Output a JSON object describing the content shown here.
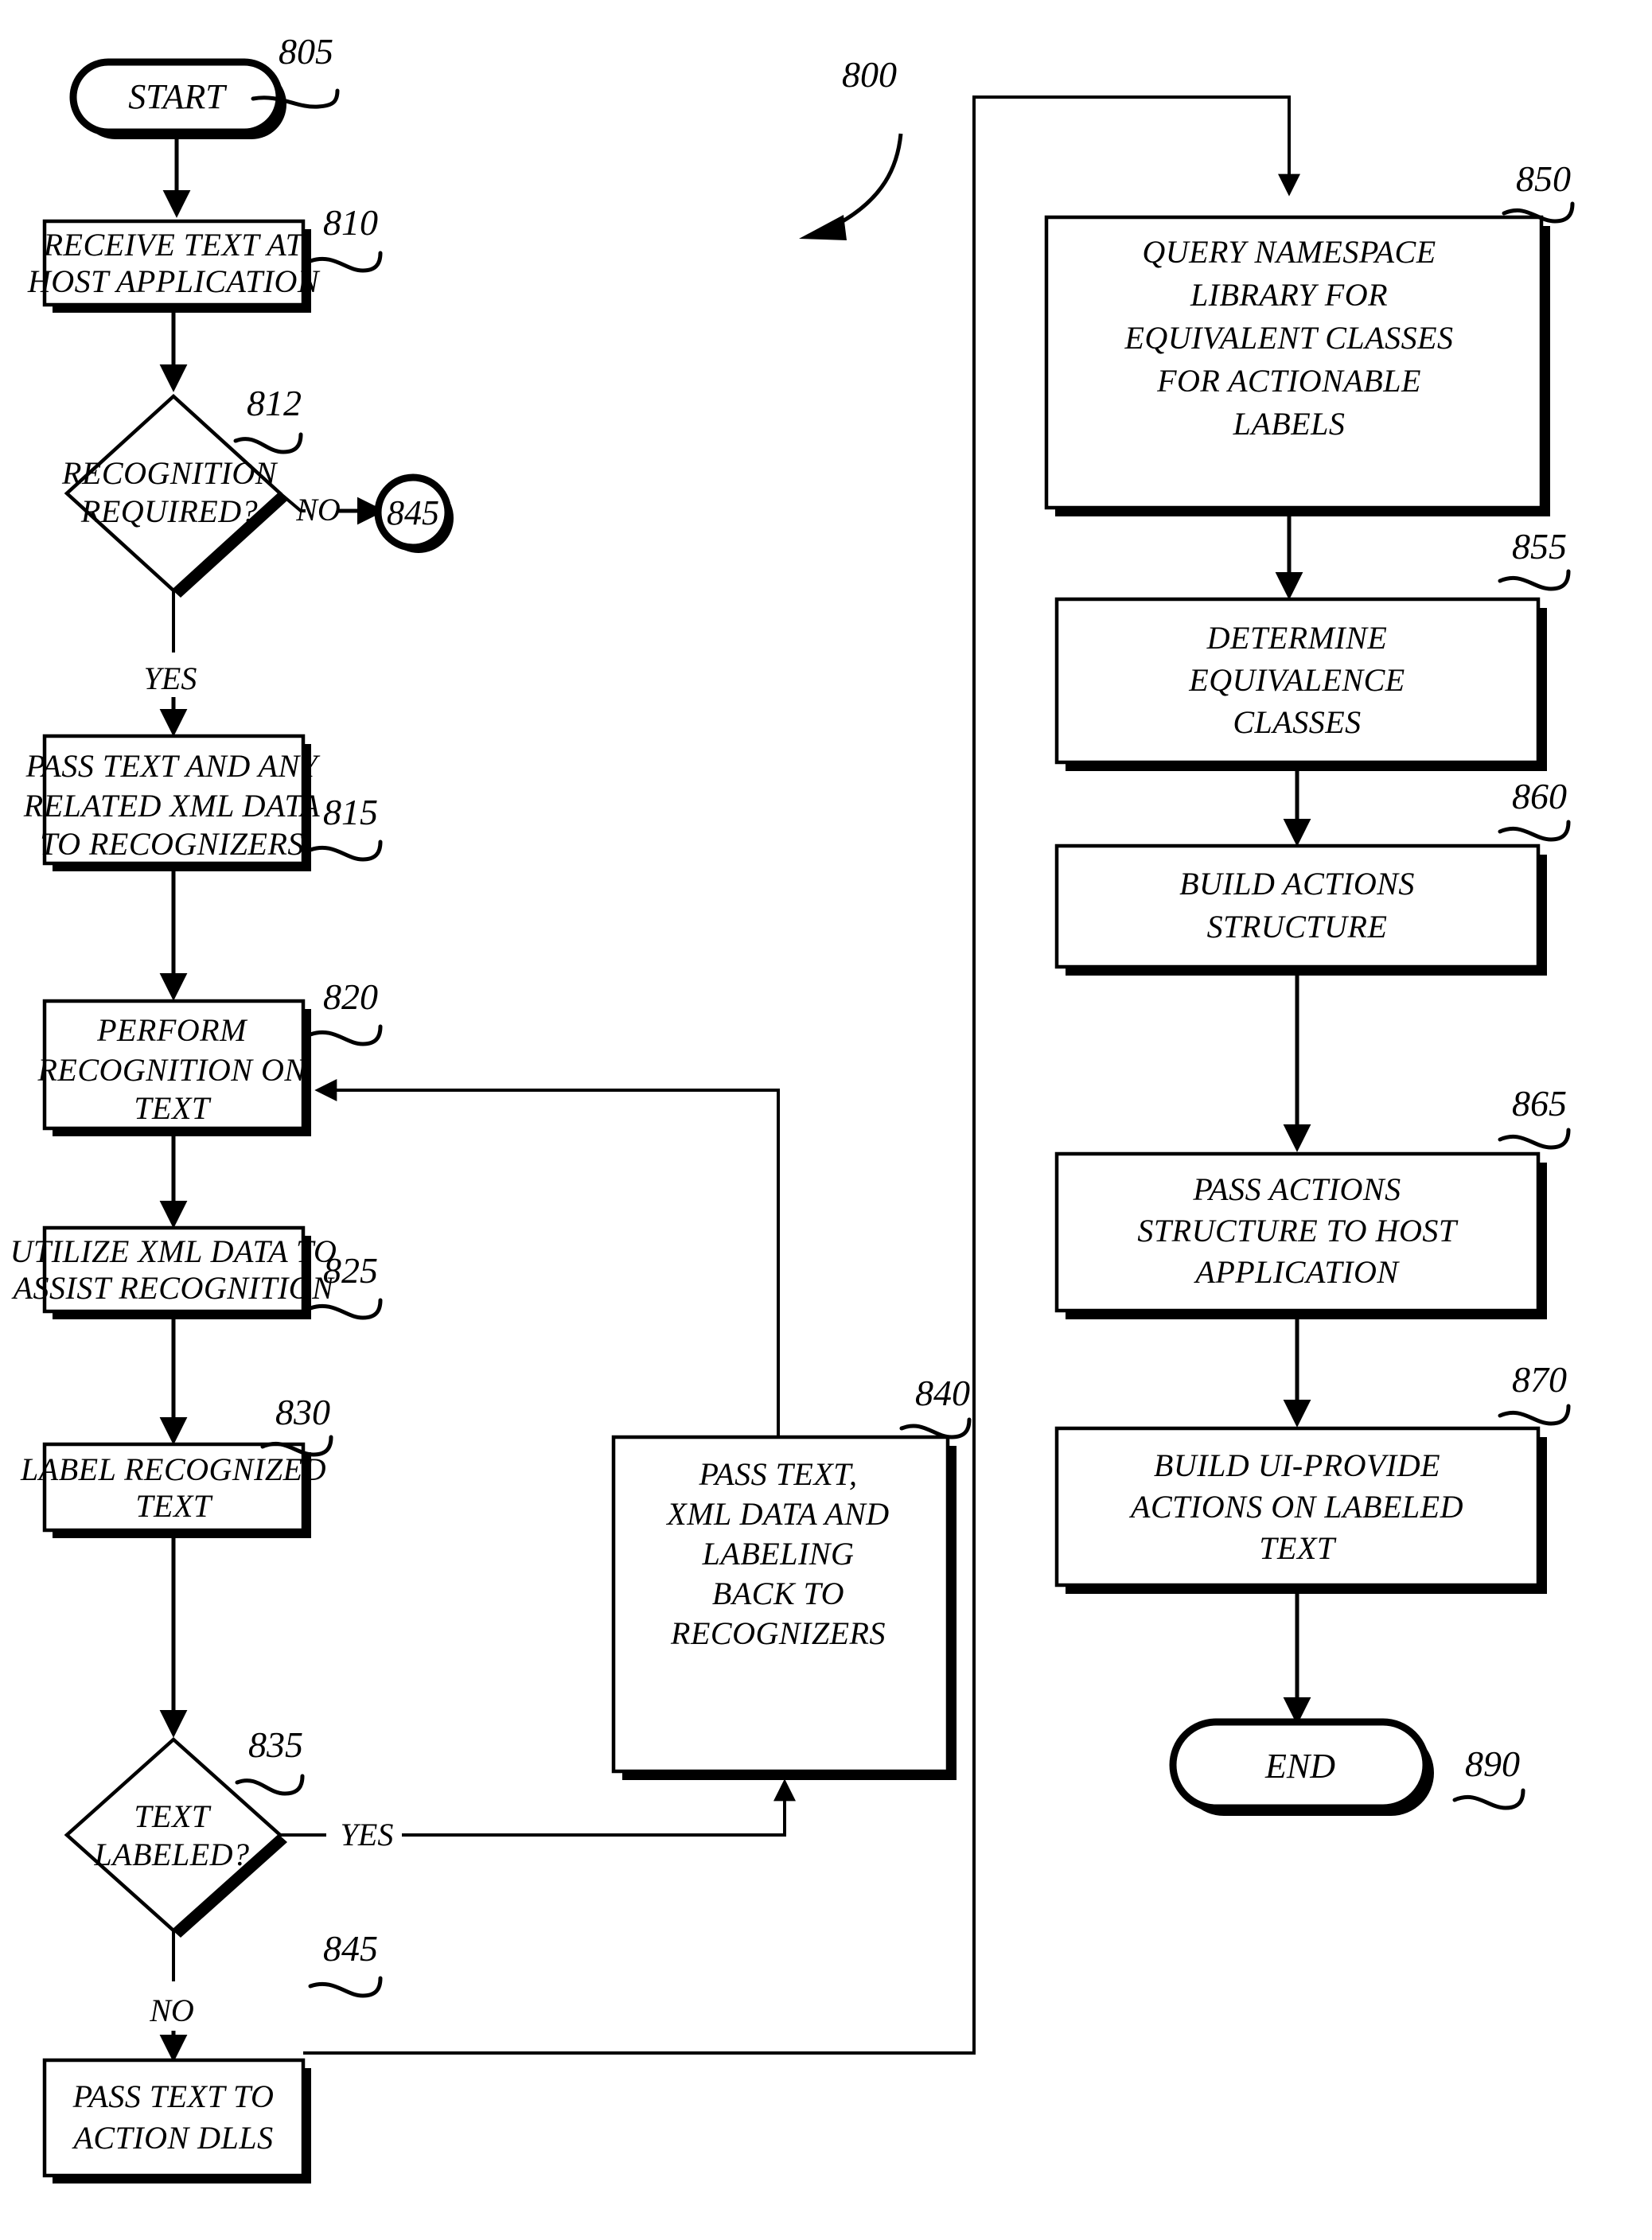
{
  "figure": {
    "figure_number": "800",
    "type": "patent-flowchart"
  },
  "nodes": {
    "start": {
      "ref": "805",
      "label": "START",
      "shape": "terminator"
    },
    "n810": {
      "ref": "810",
      "shape": "process",
      "lines": [
        "RECEIVE TEXT AT",
        "HOST APPLICATION"
      ]
    },
    "n812": {
      "ref": "812",
      "shape": "decision",
      "lines": [
        "RECOGNITION",
        "REQUIRED?"
      ]
    },
    "n815": {
      "ref": "815",
      "shape": "process",
      "lines": [
        "PASS TEXT AND ANY",
        "RELATED XML DATA",
        "TO RECOGNIZERS"
      ]
    },
    "n820": {
      "ref": "820",
      "shape": "process",
      "lines": [
        "PERFORM",
        "RECOGNITION ON",
        "TEXT"
      ]
    },
    "n825": {
      "ref": "825",
      "shape": "process",
      "lines": [
        "UTILIZE XML DATA TO",
        "ASSIST RECOGNITION"
      ]
    },
    "n830": {
      "ref": "830",
      "shape": "process",
      "lines": [
        "LABEL RECOGNIZED",
        "TEXT"
      ]
    },
    "n835": {
      "ref": "835",
      "shape": "decision",
      "lines": [
        "TEXT",
        "LABELED?"
      ]
    },
    "n840": {
      "ref": "840",
      "shape": "process",
      "lines": [
        "PASS TEXT,",
        "XML DATA AND",
        "LABELING",
        "BACK TO",
        "RECOGNIZERS"
      ]
    },
    "n845": {
      "ref": "845",
      "shape": "process",
      "lines": [
        "PASS TEXT TO",
        "ACTION DLLS"
      ]
    },
    "connector845": {
      "ref": "845",
      "label": "845",
      "shape": "connector-circle"
    },
    "n850": {
      "ref": "850",
      "shape": "process",
      "lines": [
        "QUERY NAMESPACE",
        "LIBRARY FOR",
        "EQUIVALENT CLASSES",
        "FOR ACTIONABLE",
        "LABELS"
      ]
    },
    "n855": {
      "ref": "855",
      "shape": "process",
      "lines": [
        "DETERMINE",
        "EQUIVALENCE",
        "CLASSES"
      ]
    },
    "n860": {
      "ref": "860",
      "shape": "process",
      "lines": [
        "BUILD ACTIONS",
        "STRUCTURE"
      ]
    },
    "n865": {
      "ref": "865",
      "shape": "process",
      "lines": [
        "PASS ACTIONS",
        "STRUCTURE TO HOST",
        "APPLICATION"
      ]
    },
    "n870": {
      "ref": "870",
      "shape": "process",
      "lines": [
        "BUILD UI-PROVIDE",
        "ACTIONS ON LABELED",
        "TEXT"
      ]
    },
    "end": {
      "ref": "890",
      "label": "END",
      "shape": "terminator"
    }
  },
  "edge_labels": {
    "no_812": "NO",
    "yes_812": "YES",
    "yes_835": "YES",
    "no_835": "NO"
  },
  "colors": {
    "ink": "#000000",
    "paper": "#ffffff"
  }
}
